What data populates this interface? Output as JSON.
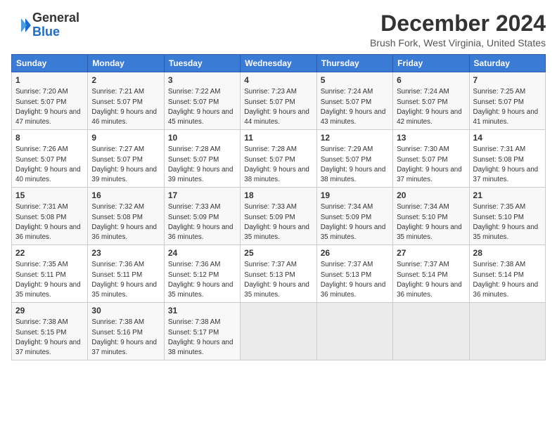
{
  "header": {
    "logo_line1": "General",
    "logo_line2": "Blue",
    "month": "December 2024",
    "location": "Brush Fork, West Virginia, United States"
  },
  "days_of_week": [
    "Sunday",
    "Monday",
    "Tuesday",
    "Wednesday",
    "Thursday",
    "Friday",
    "Saturday"
  ],
  "weeks": [
    [
      {
        "day": "1",
        "info": "Sunrise: 7:20 AM\nSunset: 5:07 PM\nDaylight: 9 hours and 47 minutes."
      },
      {
        "day": "2",
        "info": "Sunrise: 7:21 AM\nSunset: 5:07 PM\nDaylight: 9 hours and 46 minutes."
      },
      {
        "day": "3",
        "info": "Sunrise: 7:22 AM\nSunset: 5:07 PM\nDaylight: 9 hours and 45 minutes."
      },
      {
        "day": "4",
        "info": "Sunrise: 7:23 AM\nSunset: 5:07 PM\nDaylight: 9 hours and 44 minutes."
      },
      {
        "day": "5",
        "info": "Sunrise: 7:24 AM\nSunset: 5:07 PM\nDaylight: 9 hours and 43 minutes."
      },
      {
        "day": "6",
        "info": "Sunrise: 7:24 AM\nSunset: 5:07 PM\nDaylight: 9 hours and 42 minutes."
      },
      {
        "day": "7",
        "info": "Sunrise: 7:25 AM\nSunset: 5:07 PM\nDaylight: 9 hours and 41 minutes."
      }
    ],
    [
      {
        "day": "8",
        "info": "Sunrise: 7:26 AM\nSunset: 5:07 PM\nDaylight: 9 hours and 40 minutes."
      },
      {
        "day": "9",
        "info": "Sunrise: 7:27 AM\nSunset: 5:07 PM\nDaylight: 9 hours and 39 minutes."
      },
      {
        "day": "10",
        "info": "Sunrise: 7:28 AM\nSunset: 5:07 PM\nDaylight: 9 hours and 39 minutes."
      },
      {
        "day": "11",
        "info": "Sunrise: 7:28 AM\nSunset: 5:07 PM\nDaylight: 9 hours and 38 minutes."
      },
      {
        "day": "12",
        "info": "Sunrise: 7:29 AM\nSunset: 5:07 PM\nDaylight: 9 hours and 38 minutes."
      },
      {
        "day": "13",
        "info": "Sunrise: 7:30 AM\nSunset: 5:07 PM\nDaylight: 9 hours and 37 minutes."
      },
      {
        "day": "14",
        "info": "Sunrise: 7:31 AM\nSunset: 5:08 PM\nDaylight: 9 hours and 37 minutes."
      }
    ],
    [
      {
        "day": "15",
        "info": "Sunrise: 7:31 AM\nSunset: 5:08 PM\nDaylight: 9 hours and 36 minutes."
      },
      {
        "day": "16",
        "info": "Sunrise: 7:32 AM\nSunset: 5:08 PM\nDaylight: 9 hours and 36 minutes."
      },
      {
        "day": "17",
        "info": "Sunrise: 7:33 AM\nSunset: 5:09 PM\nDaylight: 9 hours and 36 minutes."
      },
      {
        "day": "18",
        "info": "Sunrise: 7:33 AM\nSunset: 5:09 PM\nDaylight: 9 hours and 35 minutes."
      },
      {
        "day": "19",
        "info": "Sunrise: 7:34 AM\nSunset: 5:09 PM\nDaylight: 9 hours and 35 minutes."
      },
      {
        "day": "20",
        "info": "Sunrise: 7:34 AM\nSunset: 5:10 PM\nDaylight: 9 hours and 35 minutes."
      },
      {
        "day": "21",
        "info": "Sunrise: 7:35 AM\nSunset: 5:10 PM\nDaylight: 9 hours and 35 minutes."
      }
    ],
    [
      {
        "day": "22",
        "info": "Sunrise: 7:35 AM\nSunset: 5:11 PM\nDaylight: 9 hours and 35 minutes."
      },
      {
        "day": "23",
        "info": "Sunrise: 7:36 AM\nSunset: 5:11 PM\nDaylight: 9 hours and 35 minutes."
      },
      {
        "day": "24",
        "info": "Sunrise: 7:36 AM\nSunset: 5:12 PM\nDaylight: 9 hours and 35 minutes."
      },
      {
        "day": "25",
        "info": "Sunrise: 7:37 AM\nSunset: 5:13 PM\nDaylight: 9 hours and 35 minutes."
      },
      {
        "day": "26",
        "info": "Sunrise: 7:37 AM\nSunset: 5:13 PM\nDaylight: 9 hours and 36 minutes."
      },
      {
        "day": "27",
        "info": "Sunrise: 7:37 AM\nSunset: 5:14 PM\nDaylight: 9 hours and 36 minutes."
      },
      {
        "day": "28",
        "info": "Sunrise: 7:38 AM\nSunset: 5:14 PM\nDaylight: 9 hours and 36 minutes."
      }
    ],
    [
      {
        "day": "29",
        "info": "Sunrise: 7:38 AM\nSunset: 5:15 PM\nDaylight: 9 hours and 37 minutes."
      },
      {
        "day": "30",
        "info": "Sunrise: 7:38 AM\nSunset: 5:16 PM\nDaylight: 9 hours and 37 minutes."
      },
      {
        "day": "31",
        "info": "Sunrise: 7:38 AM\nSunset: 5:17 PM\nDaylight: 9 hours and 38 minutes."
      },
      {
        "day": "",
        "info": ""
      },
      {
        "day": "",
        "info": ""
      },
      {
        "day": "",
        "info": ""
      },
      {
        "day": "",
        "info": ""
      }
    ]
  ]
}
